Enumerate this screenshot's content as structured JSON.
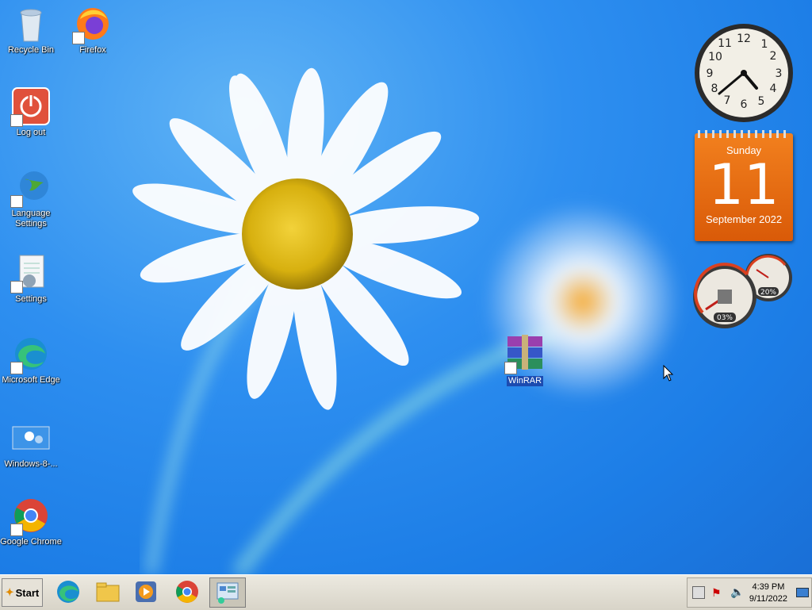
{
  "desktop_icons": [
    {
      "label": "Recycle Bin"
    },
    {
      "label": "Firefox"
    },
    {
      "label": "Log out"
    },
    {
      "label": "Language Settings"
    },
    {
      "label": "Settings"
    },
    {
      "label": "Microsoft Edge"
    },
    {
      "label": "Windows-8-..."
    },
    {
      "label": "Google Chrome"
    },
    {
      "label": "WinRAR"
    }
  ],
  "calendar": {
    "weekday": "Sunday",
    "day": "11",
    "month_year": "September 2022"
  },
  "meters": {
    "cpu": "03%",
    "memory": "20%"
  },
  "taskbar": {
    "start_label": "Start",
    "pinned": [
      "microsoft-edge",
      "file-explorer",
      "media-player",
      "google-chrome",
      "control-panel"
    ]
  },
  "tray": {
    "time": "4:39 PM",
    "date": "9/11/2022"
  }
}
